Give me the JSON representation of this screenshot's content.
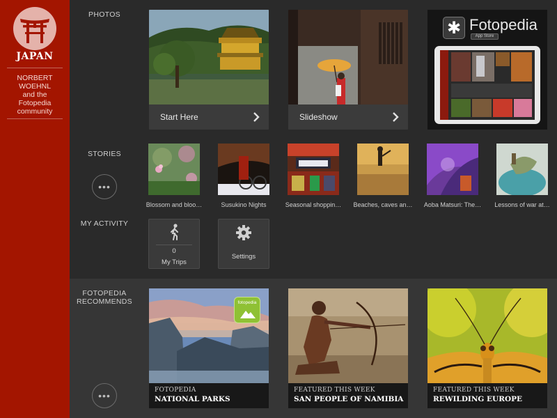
{
  "sidebar": {
    "title": "JAPAN",
    "author": "NORBERT\nWOEHNL\nand the\nFotopedia\ncommunity"
  },
  "photos": {
    "label": "PHOTOS",
    "cards": [
      {
        "label": "Start Here"
      },
      {
        "label": "Slideshow"
      }
    ],
    "promo": {
      "brand": "Fotopedia",
      "store_badge": "App Store"
    }
  },
  "stories": {
    "label": "STORIES",
    "more": "•••",
    "items": [
      {
        "title": "Blossom and bloo…"
      },
      {
        "title": "Susukino Nights"
      },
      {
        "title": "Seasonal shoppin…"
      },
      {
        "title": "Beaches, caves an…"
      },
      {
        "title": "Aoba Matsuri: The…"
      },
      {
        "title": "Lessons of war at…"
      }
    ]
  },
  "activity": {
    "label": "MY ACTIVITY",
    "trips": {
      "count": "0",
      "label": "My Trips"
    },
    "settings": {
      "label": "Settings"
    }
  },
  "recommends": {
    "label": "FOTOPEDIA\nRECOMMENDS",
    "more": "•••",
    "badge": "fotopedia",
    "cards": [
      {
        "kicker": "FOTOPEDIA",
        "headline": "NATIONAL PARKS"
      },
      {
        "kicker": "FEATURED THIS WEEK",
        "headline": "SAN PEOPLE OF NAMIBIA"
      },
      {
        "kicker": "FEATURED THIS WEEK",
        "headline": "REWILDING EUROPE"
      }
    ]
  },
  "colors": {
    "sidebar": "#a31500",
    "background": "#2a2a2a",
    "badge_green": "#8fc134"
  }
}
